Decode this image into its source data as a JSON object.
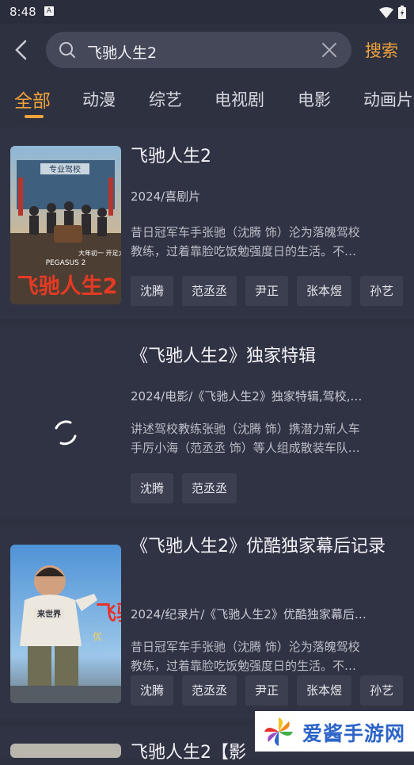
{
  "status": {
    "time": "8:48",
    "notification_badge": "A"
  },
  "header": {
    "search_value": "飞驰人生2",
    "search_button": "搜索"
  },
  "tabs": [
    {
      "label": "全部",
      "active": true
    },
    {
      "label": "动漫"
    },
    {
      "label": "综艺"
    },
    {
      "label": "电视剧"
    },
    {
      "label": "电影"
    },
    {
      "label": "动画片"
    }
  ],
  "results": [
    {
      "title": "飞驰人生2",
      "meta": "2024/喜剧片",
      "desc": [
        "昔日冠军车手张驰（沈腾 饰）沦为落魄驾校",
        "教练，过着靠脸吃饭勉强度日的生活。不…"
      ],
      "cast": [
        "沈腾",
        "范丞丞",
        "尹正",
        "张本煜",
        "孙艺"
      ],
      "poster_texts": {
        "sign": "专业驾校",
        "en": "PEGASUS 2",
        "cn": "飞驰人生2",
        "slogan": "大年初一 开足大吉"
      }
    },
    {
      "title": "《飞驰人生2》独家特辑",
      "meta": "2024/电影/《飞驰人生2》独家特辑,驾校,…",
      "desc": [
        "讲述驾校教练张驰（沈腾 饰）携潜力新人车",
        "手厉小海（范丞丞 饰）等人组成散装车队…"
      ],
      "cast": [
        "沈腾",
        "范丞丞"
      ]
    },
    {
      "title": "《飞驰人生2》优酷独家幕后记录",
      "meta": "2024/纪录片/《飞驰人生2》优酷独家幕后…",
      "desc": [
        "昔日冠军车手张驰（沈腾 饰）沦为落魄驾校",
        "教练，过着靠脸吃饭勉强度日的生活。不…"
      ],
      "cast": [
        "沈腾",
        "范丞丞",
        "尹正",
        "张本煜",
        "孙艺"
      ],
      "poster_texts": {
        "shirt": "来世界",
        "red": "飞驰",
        "orange": "优"
      }
    },
    {
      "title": "飞驰人生2【影"
    }
  ],
  "watermark": "爱酱手游网",
  "colors": {
    "accent": "#f0a23c",
    "background": "#2e3140",
    "chip": "#3c3f4f"
  }
}
